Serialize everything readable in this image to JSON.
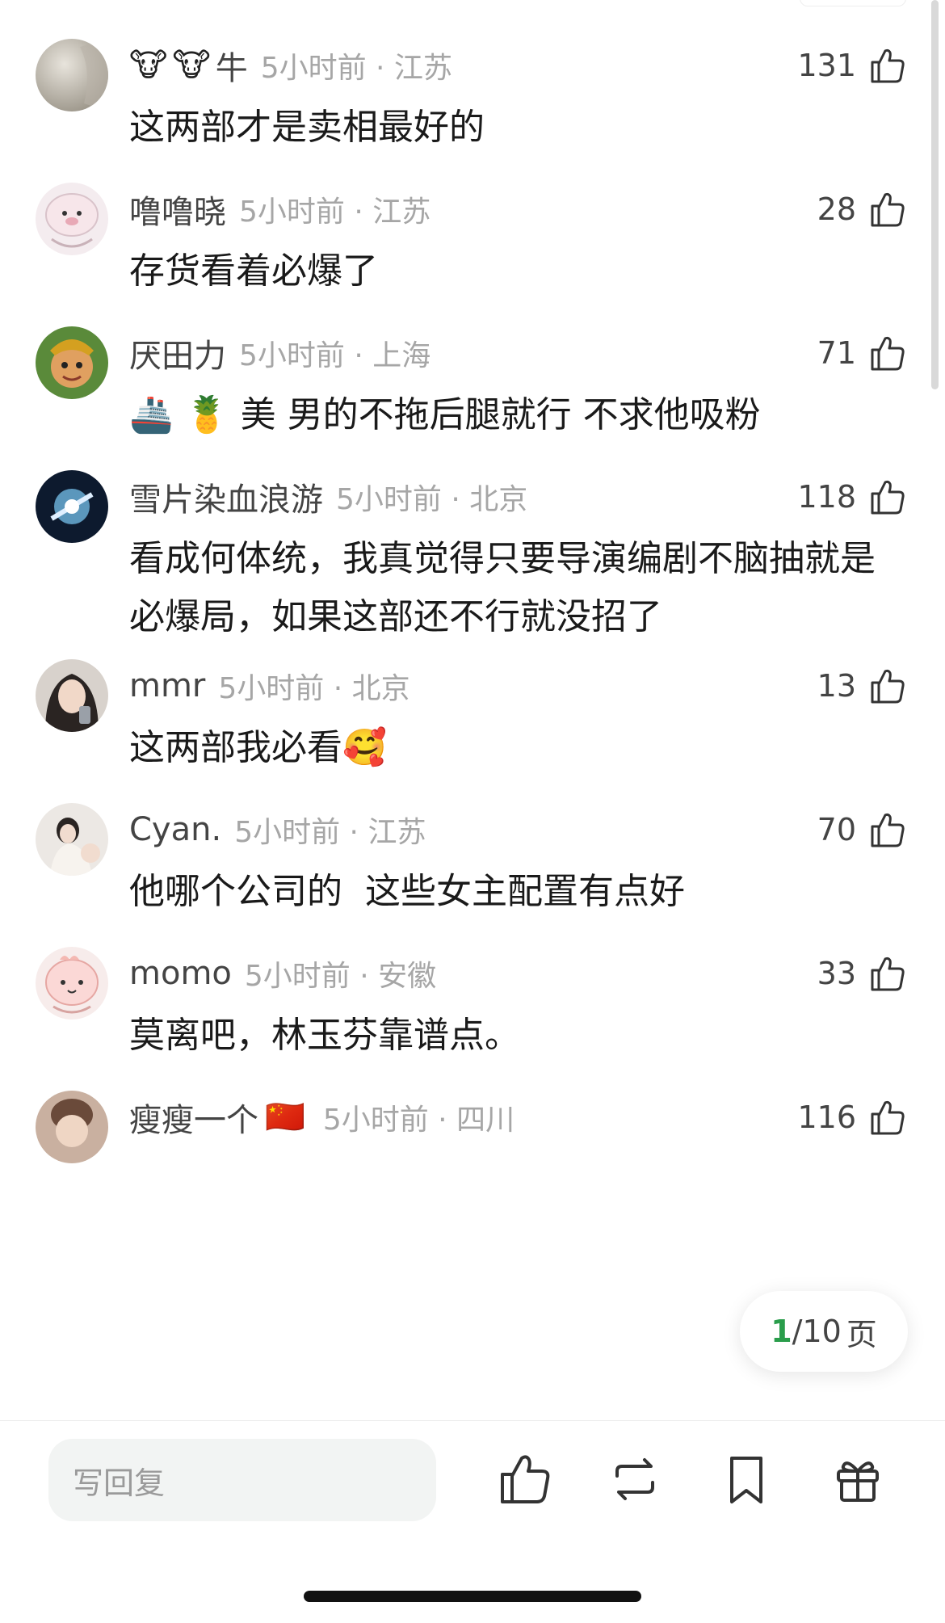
{
  "comments": [
    {
      "username": "牛",
      "name_prefix": [
        "🐮",
        "🐮"
      ],
      "time": "5小时前",
      "location": "江苏",
      "sep": "·",
      "likes": "131",
      "text": "这两部才是卖相最好的"
    },
    {
      "username": "噜噜晓",
      "time": "5小时前",
      "location": "江苏",
      "sep": "·",
      "likes": "28",
      "text": "存货看着必爆了"
    },
    {
      "username": "厌田力",
      "time": "5小时前",
      "location": "上海",
      "sep": "·",
      "likes": "71",
      "text_prefix": [
        "🚢",
        "🍍"
      ],
      "text": "美 男的不拖后腿就行 不求他吸粉"
    },
    {
      "username": "雪片染血浪游",
      "time": "5小时前",
      "location": "北京",
      "sep": "·",
      "likes": "118",
      "text": "看成何体统，我真觉得只要导演编剧不脑抽就是必爆局，如果这部还不行就没招了"
    },
    {
      "username": "mmr",
      "time": "5小时前",
      "location": "北京",
      "sep": "·",
      "likes": "13",
      "text": "这两部我必看",
      "text_suffix": "🥰"
    },
    {
      "username": "Cyan.",
      "time": "5小时前",
      "location": "江苏",
      "sep": "·",
      "likes": "70",
      "text": "他哪个公司的  这些女主配置有点好"
    },
    {
      "username": "momo",
      "time": "5小时前",
      "location": "安徽",
      "sep": "·",
      "likes": "33",
      "text": "莫离吧，林玉芬靠谱点。"
    },
    {
      "username": "瘦瘦一个",
      "name_suffix": "🇨🇳",
      "time": "5小时前",
      "location": "四川",
      "sep": "·",
      "likes": "116",
      "text": ""
    }
  ],
  "pager": {
    "current": "1",
    "total": "/10",
    "unit": "页"
  },
  "bottom_bar": {
    "reply_placeholder": "写回复"
  },
  "icons": {
    "like": "thumbs-up-icon",
    "repost": "repost-icon",
    "bookmark": "bookmark-icon",
    "gift": "gift-icon"
  },
  "colors": {
    "accent_green": "#2a9d4b",
    "muted": "#a6a6a6",
    "text": "#1a1a1a"
  }
}
